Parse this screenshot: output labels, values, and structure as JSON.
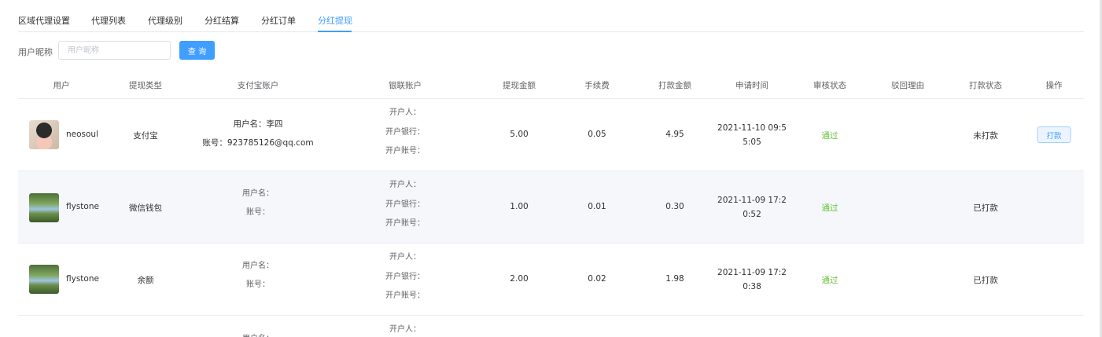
{
  "tabs": [
    {
      "label": "区域代理设置",
      "active": false
    },
    {
      "label": "代理列表",
      "active": false
    },
    {
      "label": "代理级别",
      "active": false
    },
    {
      "label": "分红结算",
      "active": false
    },
    {
      "label": "分红订单",
      "active": false
    },
    {
      "label": "分红提现",
      "active": true
    }
  ],
  "search": {
    "label": "用户昵称",
    "placeholder": "用户昵称",
    "button_label": "查 询"
  },
  "table": {
    "headers": [
      "用户",
      "提现类型",
      "支付宝账户",
      "银联账户",
      "提现金额",
      "手续费",
      "打款金额",
      "申请时间",
      "审核状态",
      "驳回理由",
      "打款状态",
      "操作"
    ],
    "rows": [
      {
        "avatar": "user-avatar-photo",
        "nickname": "neosoul",
        "type": "支付宝",
        "alipay_name": "用户名：李四",
        "alipay_account": "账号：923785126@qq.com",
        "bank_holder": "开户人：",
        "bank_name": "开户银行：",
        "bank_account": "开户账号：",
        "amount": "5.00",
        "fee": "0.05",
        "paid": "4.95",
        "time_line1": "2021-11-10 09:5",
        "time_line2": "5:05",
        "audit": "通过",
        "reason": "",
        "pay_status": "未打款",
        "action": "打款"
      },
      {
        "avatar": "user-avatar-photo",
        "nickname": "flystone",
        "type": "微信钱包",
        "alipay_name": "用户名：",
        "alipay_account": "账号：",
        "bank_holder": "开户人：",
        "bank_name": "开户银行：",
        "bank_account": "开户账号：",
        "amount": "1.00",
        "fee": "0.01",
        "paid": "0.30",
        "time_line1": "2021-11-09 17:2",
        "time_line2": "0:52",
        "audit": "通过",
        "reason": "",
        "pay_status": "已打款",
        "action": ""
      },
      {
        "avatar": "user-avatar-photo",
        "nickname": "flystone",
        "type": "余额",
        "alipay_name": "用户名：",
        "alipay_account": "账号：",
        "bank_holder": "开户人：",
        "bank_name": "开户银行：",
        "bank_account": "开户账号：",
        "amount": "2.00",
        "fee": "0.02",
        "paid": "1.98",
        "time_line1": "2021-11-09 17:2",
        "time_line2": "0:38",
        "audit": "通过",
        "reason": "",
        "pay_status": "已打款",
        "action": ""
      },
      {
        "partial": true,
        "alipay_name": "用户名：",
        "bank_holder": "开户人："
      }
    ]
  },
  "colors": {
    "accent": "#409eff",
    "success": "#67c23a",
    "stripe": "#f5f7fa"
  }
}
